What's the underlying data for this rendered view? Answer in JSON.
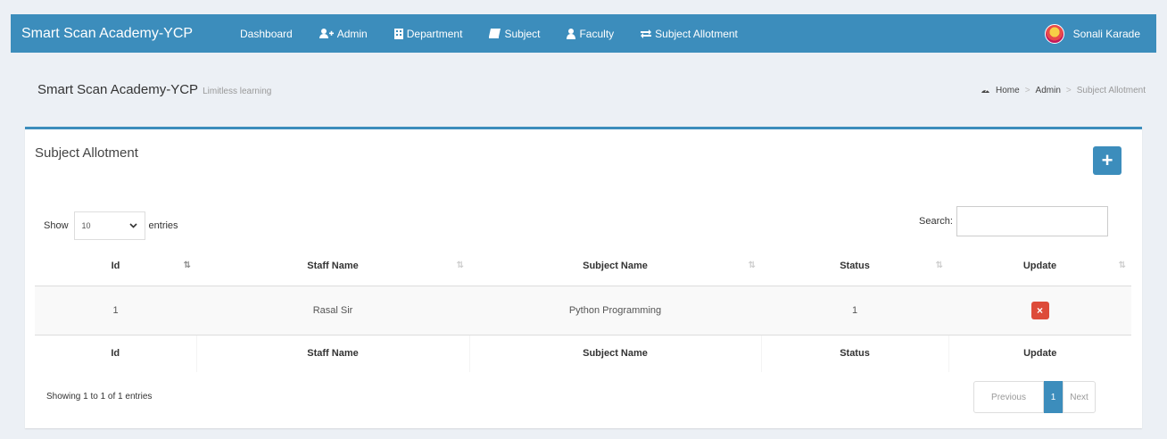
{
  "navbar": {
    "brand": "Smart Scan Academy-YCP",
    "items": [
      {
        "label": "Dashboard",
        "icon": ""
      },
      {
        "label": "Admin",
        "icon": "user-plus-icon"
      },
      {
        "label": "Department",
        "icon": "building-icon"
      },
      {
        "label": "Subject",
        "icon": "book-icon"
      },
      {
        "label": "Faculty",
        "icon": "user-icon"
      },
      {
        "label": "Subject Allotment",
        "icon": "exchange-icon"
      }
    ],
    "user_name": "Sonali Karade"
  },
  "header": {
    "title": "Smart Scan Academy-YCP",
    "subtitle": "Limitless learning"
  },
  "breadcrumb": {
    "home": "Home",
    "admin": "Admin",
    "current": "Subject Allotment"
  },
  "box": {
    "title": "Subject Allotment",
    "add_label": "+"
  },
  "controls": {
    "show_label": "Show",
    "entries_value": "10",
    "entries_label": "entries",
    "search_label": "Search:",
    "search_value": ""
  },
  "table": {
    "columns": [
      "Id",
      "Staff Name",
      "Subject Name",
      "Status",
      "Update"
    ],
    "rows": [
      {
        "id": "1",
        "staff": "Rasal Sir",
        "subject": "Python Programming",
        "status": "1",
        "update": "×"
      }
    ]
  },
  "footer": {
    "info": "Showing 1 to 1 of 1 entries",
    "previous": "Previous",
    "page": "1",
    "next": "Next"
  },
  "colors": {
    "primary": "#3c8dbc",
    "danger": "#dd4b39",
    "background": "#ecf0f5"
  }
}
